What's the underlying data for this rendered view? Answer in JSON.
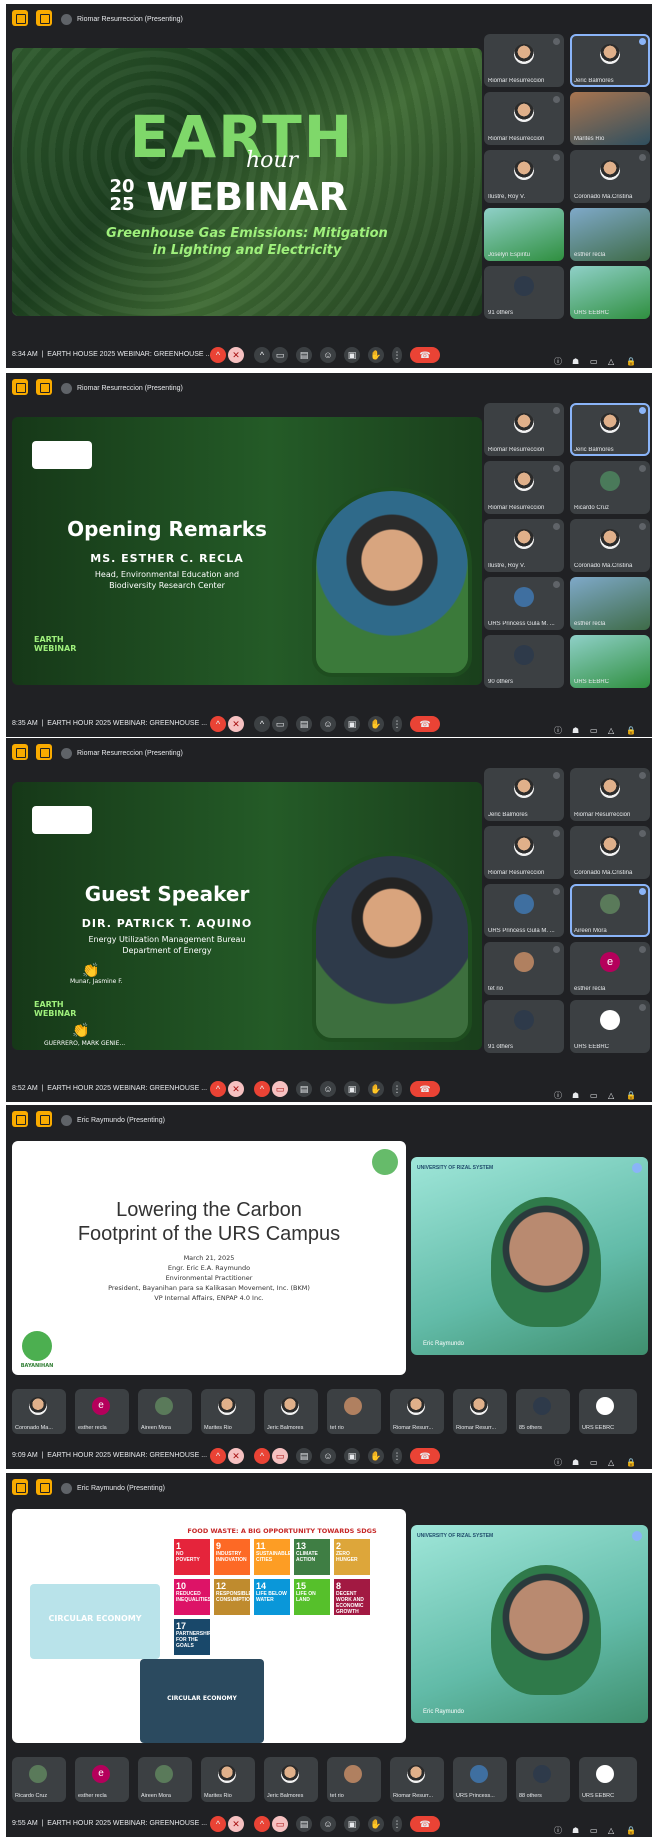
{
  "frames": [
    {
      "presenter": "Riomar Resurreccion (Presenting)",
      "time": "8:34 AM",
      "meeting": "EARTH HOUSE 2025 WEBINAR: GREENHOUSE ...",
      "slide": {
        "kind": "earth",
        "line1": "EARTH",
        "line2": "hour",
        "year_top": "20",
        "year_bottom": "25",
        "line3": "WEBINAR",
        "subtitle1": "Greenhouse Gas Emissions: Mitigation",
        "subtitle2": "in Lighting and Electricity"
      },
      "tiles": [
        {
          "name": "Riomar Resurreccion"
        },
        {
          "name": "Jeric Balmores"
        },
        {
          "name": "Riomar Resurreccion"
        },
        {
          "name": "Marites Rio"
        },
        {
          "name": "Ilustre, Roy V."
        },
        {
          "name": "Coronado Ma.Cristina"
        },
        {
          "name": "Joselyn Espiritu"
        },
        {
          "name": "esther recla"
        },
        {
          "name": "91 others"
        },
        {
          "name": "URS EEBRC"
        }
      ]
    },
    {
      "presenter": "Riomar Resurreccion (Presenting)",
      "time": "8:35 AM",
      "meeting": "EARTH HOUR 2025 WEBINAR: GREENHOUSE ...",
      "slide": {
        "kind": "speaker",
        "heading": "Opening Remarks",
        "name": "MS. ESTHER C. RECLA",
        "role1": "Head, Environmental Education and",
        "role2": "Biodiversity Research Center",
        "badge": "EARTH WEBINAR"
      },
      "tiles": [
        {
          "name": "Riomar Resurreccion"
        },
        {
          "name": "Jeric Balmores"
        },
        {
          "name": "Riomar Resurreccion"
        },
        {
          "name": "Ricardo Cruz"
        },
        {
          "name": "Ilustre, Roy V."
        },
        {
          "name": "Coronado Ma.Cristina"
        },
        {
          "name": "URS Princess Gula M. ..."
        },
        {
          "name": "esther recla"
        },
        {
          "name": "90 others"
        },
        {
          "name": "URS EEBRC"
        }
      ]
    },
    {
      "presenter": "Riomar Resurreccion (Presenting)",
      "time": "8:52 AM",
      "meeting": "EARTH HOUR 2025 WEBINAR: GREENHOUSE ...",
      "slide": {
        "kind": "speaker",
        "heading": "Guest Speaker",
        "name": "DIR. PATRICK T. AQUINO",
        "role1": "Energy Utilization Management Bureau",
        "role2": "Department of Energy",
        "badge": "EARTH WEBINAR",
        "reaction1": "Munar, Jasmine F.",
        "reaction2": "GUERRERO, MARK GENIE..."
      },
      "tiles": [
        {
          "name": "Jeric Balmores"
        },
        {
          "name": "Riomar Resurreccion"
        },
        {
          "name": "Riomar Resurreccion"
        },
        {
          "name": "Coronado Ma.Cristina"
        },
        {
          "name": "URS Princess Gula M. ..."
        },
        {
          "name": "Aireen Mora"
        },
        {
          "name": "tet rio"
        },
        {
          "name": "esther recla"
        },
        {
          "name": "91 others"
        },
        {
          "name": "URS EEBRC"
        }
      ]
    },
    {
      "presenter": "Eric Raymundo (Presenting)",
      "time": "9:09 AM",
      "meeting": "EARTH HOUR 2025 WEBINAR: GREENHOUSE ...",
      "slide": {
        "kind": "white",
        "title1": "Lowering the Carbon",
        "title2": "Footprint of the URS Campus",
        "date": "March 21, 2025",
        "by": "Engr. Eric E.A. Raymundo",
        "l1": "Environmental Practitioner",
        "l2": "President, Bayanihan para sa Kalikasan Movement, Inc. (BKM)",
        "l3": "VP Internal Affairs, ENPAP 4.0 Inc.",
        "logo": "BAYANIHAN"
      },
      "cam": {
        "head": "UNIVERSITY OF RIZAL SYSTEM",
        "name": "Eric Raymundo"
      },
      "strip": [
        {
          "name": "Coronado Ma..."
        },
        {
          "name": "esther recla"
        },
        {
          "name": "Aireen Mora"
        },
        {
          "name": "Marites Rio"
        },
        {
          "name": "Jeric Balmores"
        },
        {
          "name": "tet rio"
        },
        {
          "name": "Riomar Resurr..."
        },
        {
          "name": "Riomar Resurr..."
        },
        {
          "name": "85 others"
        },
        {
          "name": "URS EEBRC"
        }
      ]
    },
    {
      "presenter": "Eric Raymundo (Presenting)",
      "time": "9:55 AM",
      "meeting": "EARTH HOUR 2025 WEBINAR: GREENHOUSE ...",
      "slide": {
        "kind": "sdg",
        "title": "FOOD WASTE: A BIG OPPORTUNITY TOWARDS SDGS",
        "circ1": "CIRCULAR ECONOMY",
        "circ2": "CIRCULAR ECONOMY"
      },
      "cam": {
        "head": "UNIVERSITY OF RIZAL SYSTEM",
        "name": "Eric Raymundo"
      },
      "strip": [
        {
          "name": "Ricardo Cruz"
        },
        {
          "name": "esther recla"
        },
        {
          "name": "Aireen Mora"
        },
        {
          "name": "Marites Rio"
        },
        {
          "name": "Jeric Balmores"
        },
        {
          "name": "tet rio"
        },
        {
          "name": "Riomar Resurr..."
        },
        {
          "name": "URS Princess..."
        },
        {
          "name": "88 others"
        },
        {
          "name": "URS EEBRC"
        }
      ]
    }
  ],
  "sdgs": [
    {
      "n": "1",
      "t": "NO POVERTY",
      "c": "#e5243b"
    },
    {
      "n": "9",
      "t": "INDUSTRY INNOVATION",
      "c": "#fd6925"
    },
    {
      "n": "11",
      "t": "SUSTAINABLE CITIES",
      "c": "#fd9d24"
    },
    {
      "n": "13",
      "t": "CLIMATE ACTION",
      "c": "#3f7e44"
    },
    {
      "n": "2",
      "t": "ZERO HUNGER",
      "c": "#dda63a"
    },
    {
      "n": "10",
      "t": "REDUCED INEQUALITIES",
      "c": "#dd1367"
    },
    {
      "n": "12",
      "t": "RESPONSIBLE CONSUMPTION",
      "c": "#bf8b2e"
    },
    {
      "n": "14",
      "t": "LIFE BELOW WATER",
      "c": "#0a97d9"
    },
    {
      "n": "15",
      "t": "LIFE ON LAND",
      "c": "#56c02b"
    },
    {
      "n": "8",
      "t": "DECENT WORK AND ECONOMIC GROWTH",
      "c": "#a21942"
    },
    {
      "n": "17",
      "t": "PARTNERSHIPS FOR THE GOALS",
      "c": "#19486a"
    }
  ]
}
